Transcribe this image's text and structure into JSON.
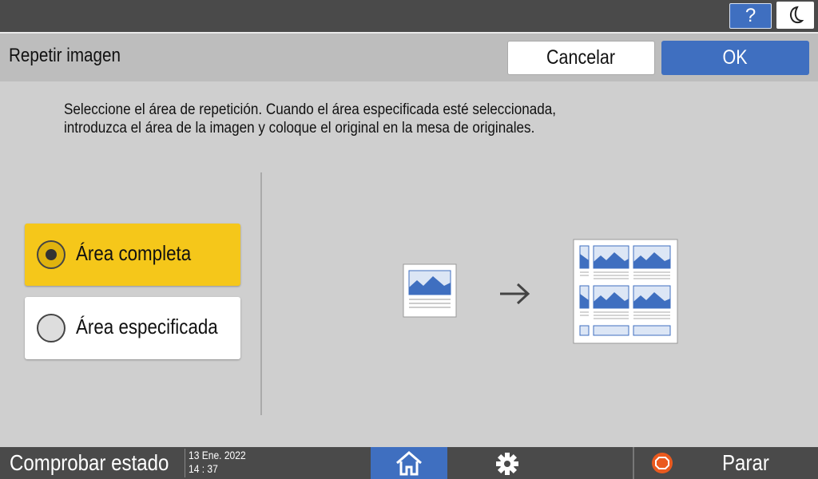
{
  "topbar": {
    "help_label": "?",
    "help_icon": "question-icon",
    "sleep_icon": "moon-icon"
  },
  "header": {
    "title": "Repetir imagen",
    "cancel_label": "Cancelar",
    "ok_label": "OK"
  },
  "main": {
    "instruction_line1": "Seleccione el área de repetición. Cuando el área especificada esté seleccionada,",
    "instruction_line2": "introduzca el área de la imagen y coloque el original en la mesa de originales.",
    "options": [
      {
        "label": "Área completa",
        "selected": true
      },
      {
        "label": "Área especificada",
        "selected": false
      }
    ],
    "illustration": {
      "source_icon": "single-image-page-icon",
      "arrow_icon": "arrow-right-icon",
      "result_icon": "repeated-images-page-icon"
    }
  },
  "footer": {
    "check_status_label": "Comprobar estado",
    "date": "13 Ene. 2022",
    "time": "14 : 37",
    "home_icon": "home-icon",
    "settings_icon": "gear-icon",
    "stop_label": "Parar",
    "stop_icon": "stop-icon"
  },
  "colors": {
    "accent_blue": "#3f6fc0",
    "selected_yellow": "#f5c71a",
    "stop_orange": "#ea5a1f",
    "bar_dark": "#4a4a4a"
  }
}
